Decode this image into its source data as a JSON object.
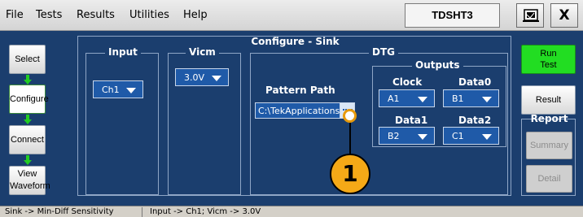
{
  "menu": [
    "File",
    "Tests",
    "Results",
    "Utilities",
    "Help"
  ],
  "instrument": "TDSHT3",
  "close_label": "X",
  "nav": {
    "select": "Select",
    "configure": "Configure",
    "connect": "Connect",
    "view_waveform_1": "View",
    "view_waveform_2": "Waveform"
  },
  "panel": {
    "title": "Configure - Sink",
    "input": {
      "title": "Input",
      "value": "Ch1"
    },
    "vicm": {
      "title": "Vicm",
      "value": "3.0V"
    },
    "dtg": {
      "title": "DTG",
      "pattern_path_label": "Pattern Path",
      "pattern_path_value": "C:\\TekApplications",
      "outputs": {
        "title": "Outputs",
        "clock": {
          "label": "Clock",
          "value": "A1"
        },
        "data0": {
          "label": "Data0",
          "value": "B1"
        },
        "data1": {
          "label": "Data1",
          "value": "B2"
        },
        "data2": {
          "label": "Data2",
          "value": "C1"
        }
      }
    }
  },
  "right": {
    "run_1": "Run",
    "run_2": "Test",
    "result": "Result",
    "report_title": "Report",
    "summary": "Summary",
    "detail": "Detail"
  },
  "callout_number": "1",
  "status": {
    "left": "Sink -> Min-Diff Sensitivity",
    "right": "Input -> Ch1; Vicm -> 3.0V"
  },
  "colors": {
    "panel_bg": "#1b3e6e",
    "dropdown_bg": "#1f5aa8",
    "run_green": "#22dd22",
    "callout_orange": "#f5a917"
  }
}
